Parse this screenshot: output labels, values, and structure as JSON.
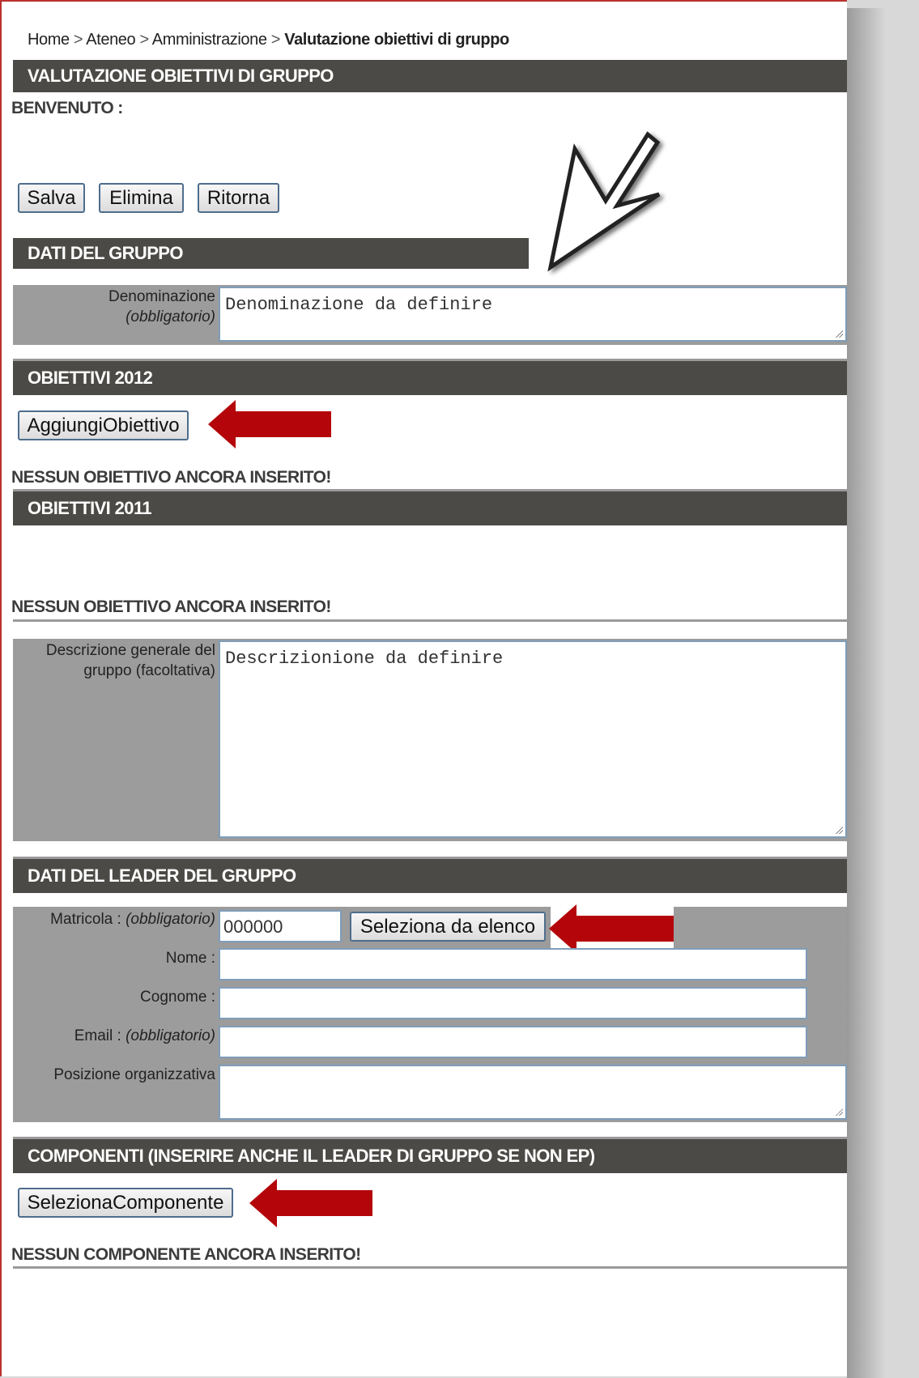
{
  "breadcrumb": {
    "home": "Home",
    "sep1": ">",
    "ateneo": "Ateneo",
    "sep2": ">",
    "amministrazione": "Amministrazione",
    "sep3": ">",
    "current": "Valutazione obiettivi di gruppo"
  },
  "page_title": "VALUTAZIONE OBIETTIVI DI GRUPPO",
  "welcome": "BENVENUTO :",
  "toolbar": {
    "save": "Salva",
    "delete": "Elimina",
    "back": "Ritorna"
  },
  "group_section": {
    "title": "DATI DEL GRUPPO",
    "name_label": "Denominazione",
    "name_required": "(obbligatorio)",
    "name_value": "Denominazione da definire"
  },
  "objectives_2012": {
    "title": "OBIETTIVI 2012",
    "add_button": "AggiungiObiettivo",
    "empty": "NESSUN OBIETTIVO ANCORA INSERITO!"
  },
  "objectives_2011": {
    "title": "OBIETTIVI 2011",
    "empty": "NESSUN OBIETTIVO ANCORA INSERITO!"
  },
  "description": {
    "label_line1": "Descrizione generale del",
    "label_line2": "gruppo (facoltativa)",
    "value": "Descrizionione da definire"
  },
  "leader_section": {
    "title": "DATI DEL LEADER DEL GRUPPO",
    "matricola_label": "Matricola :",
    "matricola_required": "(obbligatorio)",
    "matricola_value": "000000",
    "select_button": "Seleziona da elenco",
    "nome_label": "Nome :",
    "cognome_label": "Cognome :",
    "email_label": "Email :",
    "email_required": "(obbligatorio)",
    "posizione_label": "Posizione organizzativa"
  },
  "components_section": {
    "title": "COMPONENTI (INSERIRE ANCHE IL LEADER DI GRUPPO SE NON EP)",
    "select_button": "SelezionaComponente",
    "empty": "NESSUN COMPONENTE ANCORA INSERITO!"
  },
  "colors": {
    "header_bg": "#4b4a46",
    "label_bg": "#9c9c9c",
    "annotation_arrow": "#b4060a",
    "frame_border": "#b9312e"
  },
  "icons": [
    "cursor-arrow-annotation",
    "red-arrow-annotation"
  ]
}
